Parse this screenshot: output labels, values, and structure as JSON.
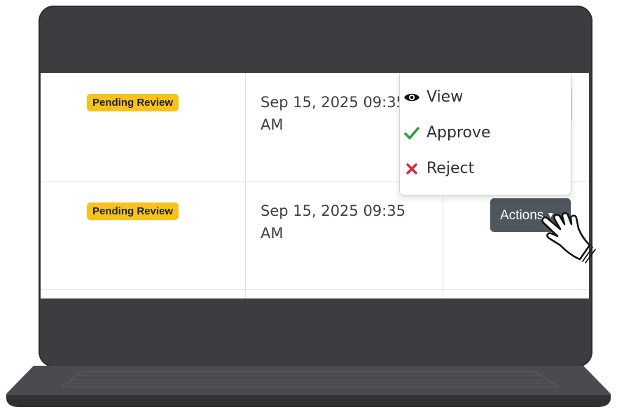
{
  "rows": [
    {
      "status": "Pending Review",
      "date": "Sep 15, 2025 09:35",
      "time": "AM"
    },
    {
      "status": "Pending Review",
      "date": "Sep 15, 2025 09:35",
      "time": "AM",
      "actions_label": "Actions"
    }
  ],
  "dropdown": {
    "items": [
      {
        "label": "View",
        "icon": "eye-icon"
      },
      {
        "label": "Approve",
        "icon": "check-icon"
      },
      {
        "label": "Reject",
        "icon": "x-icon"
      }
    ]
  },
  "colors": {
    "badge": "#f7c21a",
    "button": "#4f565d",
    "approve": "#2e9e3e",
    "reject": "#d9263a",
    "laptop": "#3c3d41"
  }
}
